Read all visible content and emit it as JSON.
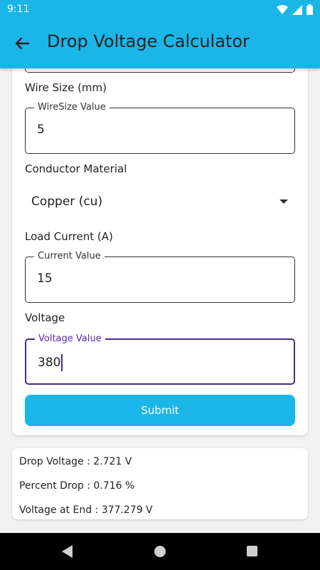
{
  "status_bar": {
    "time": "9:11"
  },
  "app_bar": {
    "title": "Drop Voltage Calculator"
  },
  "form": {
    "wire_size": {
      "label": "Wire Size (mm)",
      "float_label": "WireSize Value",
      "value": "5"
    },
    "conductor": {
      "label": "Conductor Material",
      "selected": "Copper (cu)"
    },
    "load_current": {
      "label": "Load Current (A)",
      "float_label": "Current Value",
      "value": "15"
    },
    "voltage": {
      "label": "Voltage",
      "float_label": "Voltage Value",
      "value": "380"
    },
    "submit_label": "Submit"
  },
  "results": {
    "drop_voltage": "Drop Voltage : 2.721 V",
    "percent_drop": "Percent Drop : 0.716 %",
    "voltage_at_end": "Voltage at End : 377.279 V"
  },
  "colors": {
    "primary": "#1ab6e8",
    "focus": "#4a2a8a"
  }
}
